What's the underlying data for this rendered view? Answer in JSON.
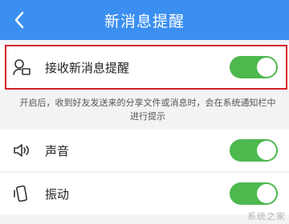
{
  "header": {
    "title": "新消息提醒",
    "back_icon": "chevron-left-icon",
    "background": "#3b8ff0"
  },
  "settings": {
    "notify": {
      "label": "接收新消息提醒",
      "icon": "person-message-icon",
      "enabled": true
    },
    "description": "开启后，收到好友发送来的分享文件或消息时，会在系统通知栏中进行提示",
    "sound": {
      "label": "声音",
      "icon": "speaker-icon",
      "enabled": true
    },
    "vibrate": {
      "label": "振动",
      "icon": "vibrate-phone-icon",
      "enabled": true
    }
  },
  "colors": {
    "toggle_on": "#4cb84e",
    "highlight_border": "#d8222b"
  },
  "watermark": "系统之家"
}
